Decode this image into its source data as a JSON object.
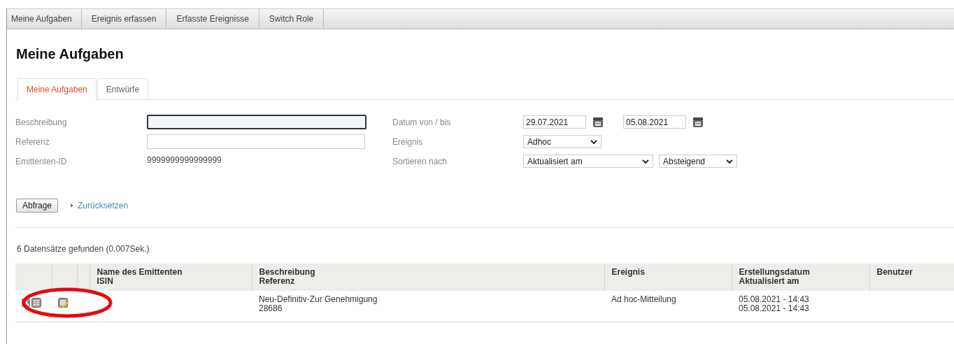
{
  "menu": [
    {
      "label": "Meine Aufgaben"
    },
    {
      "label": "Ereignis erfassen"
    },
    {
      "label": "Erfasste Ereignisse"
    },
    {
      "label": "Switch Role"
    }
  ],
  "title": "Meine Aufgaben",
  "tabs": [
    {
      "label": "Meine Aufgaben",
      "selected": true
    },
    {
      "label": "Entwürfe",
      "selected": false
    }
  ],
  "filters_left": [
    {
      "label": "Beschreibung",
      "kind": "input",
      "focused": true
    },
    {
      "label": "Referenz",
      "kind": "input",
      "focused": false
    },
    {
      "label": "Emittenten-ID",
      "kind": "static",
      "value": "9999999999999999"
    }
  ],
  "filters_right": [
    {
      "label": "Datum von / bis",
      "kind": "dates",
      "values": [
        "29.07.2021",
        "05.08.2021"
      ]
    },
    {
      "label": "Ereignis",
      "kind": "select",
      "values": [
        "Adhoc"
      ]
    },
    {
      "label": "Sortieren nach",
      "kind": "select",
      "values": [
        "Aktualisiert am",
        "Absteigend"
      ]
    }
  ],
  "query_button": "Abfrage",
  "reset_link": "Zurücksetzen",
  "result_count": "6 Datensätze gefunden (0.007Sek.)",
  "table": {
    "columns": [
      {},
      {},
      {},
      {
        "lines": [
          "Name des Emittenten",
          "ISIN"
        ]
      },
      {
        "lines": [
          "Beschreibung",
          "Referenz"
        ]
      },
      {
        "lines": [
          "Ereignis"
        ]
      },
      {
        "lines": [
          "Erstellungsdatum",
          "Aktualisiert am"
        ]
      },
      {
        "lines": [
          "Benutzer"
        ]
      }
    ],
    "rows": [
      {
        "cells": [
          {
            "kind": "view-icons"
          },
          {
            "kind": "edit-icon"
          },
          {
            "kind": "empty"
          },
          {
            "kind": "empty"
          },
          {
            "kind": "text",
            "lines": [
              "Neu-Definitiv-Zur Genehmigung",
              "28686"
            ]
          },
          {
            "kind": "text",
            "lines": [
              "Ad hoc-Mitteilung"
            ]
          },
          {
            "kind": "text",
            "lines": [
              "05.08.2021 - 14:43",
              "05.08.2021 - 14:43"
            ]
          },
          {
            "kind": "empty"
          }
        ]
      }
    ]
  },
  "annotation": {
    "kind": "ellipse"
  }
}
